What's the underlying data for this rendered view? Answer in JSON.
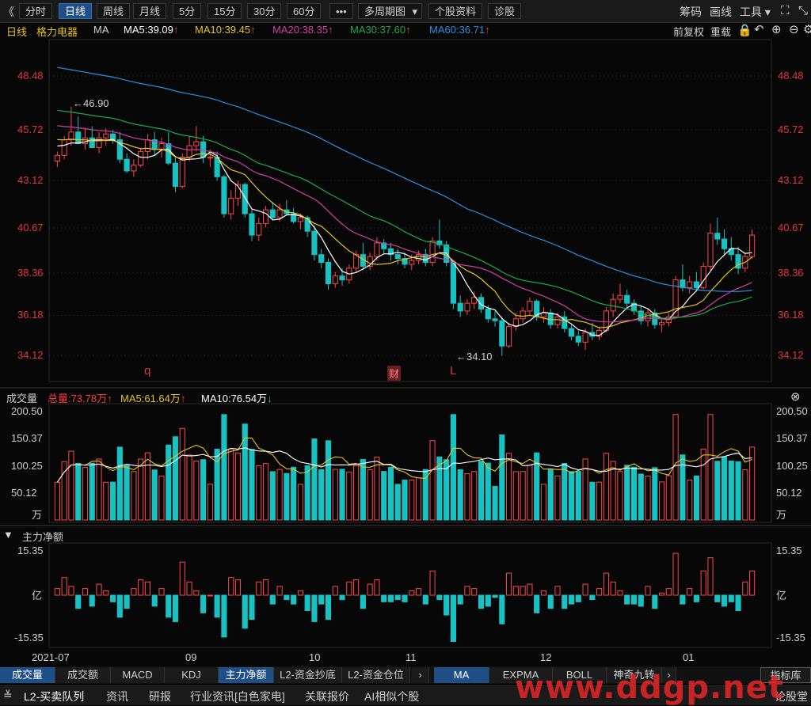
{
  "toolbar": {
    "back": "《",
    "periods": [
      "分时",
      "日线",
      "周线",
      "月线",
      "5分",
      "15分",
      "30分",
      "60分"
    ],
    "more": "•••",
    "multi_period": "多周期图",
    "stock_info": "个股资料",
    "diagnose": "诊股",
    "chips": "筹码",
    "drawing": "画线",
    "tools": "工具"
  },
  "ma_line": {
    "period": "日线",
    "stock": "格力电器",
    "ma_label": "MA",
    "ma5": "MA5:39.09",
    "ma10": "MA10:39.45",
    "ma20": "MA20:38.35",
    "ma30": "MA30:37.60",
    "ma60": "MA60:36.71",
    "adjust": "前复权",
    "reload": "重载",
    "colors": {
      "ma5": "#ffffff",
      "ma10": "#e8c21e",
      "ma20": "#d23ea8",
      "ma30": "#1faa4c",
      "ma60": "#2f8fe0"
    }
  },
  "price_axis": [
    "48.48",
    "45.72",
    "43.12",
    "40.67",
    "38.36",
    "36.18",
    "34.12"
  ],
  "annotations": {
    "high": "46.90",
    "low": "34.10",
    "q_marker": "q",
    "fin_marker": "财",
    "l_marker": "L"
  },
  "volume": {
    "title": "成交量",
    "total": "总量:73.78万",
    "ma5": "MA5:61.64万",
    "ma10": "MA10:76.54万",
    "axis": [
      "200.50",
      "150.37",
      "100.25",
      "50.12"
    ],
    "unit": "万"
  },
  "netflow": {
    "title": "主力净额",
    "axis_top": "15.35",
    "unit": "亿",
    "axis_bottom": "-15.35"
  },
  "x_axis": [
    "2021-07",
    "09",
    "10",
    "11",
    "12",
    "01"
  ],
  "indicator_tabs": [
    "成交量",
    "成交额",
    "MACD",
    "KDJ",
    "主力净额",
    "L2-资金抄底",
    "L2-资金仓位"
  ],
  "overlay_tabs": [
    "MA",
    "EXPMA",
    "BOLL",
    "神奇九转"
  ],
  "indicator_lib": "指标库",
  "status_tabs": [
    "L2-买卖队列",
    "资讯",
    "研报",
    "行业资讯[白色家电]",
    "关联报价",
    "AI相似个股",
    "论股堂"
  ],
  "watermark": "www.ddgp.net",
  "chart_data": {
    "type": "candlestick",
    "price_ylim": [
      34.12,
      48.48
    ],
    "volume_ylim": [
      0,
      200.5
    ],
    "netflow_ylim": [
      -15.35,
      15.35
    ],
    "candles": [
      [
        44.1,
        44.6,
        43.8,
        44.4
      ],
      [
        44.4,
        45.4,
        44.2,
        45.2
      ],
      [
        45.2,
        46.9,
        44.9,
        45.6
      ],
      [
        45.6,
        46.4,
        45.3,
        45.0
      ],
      [
        45.0,
        45.8,
        44.7,
        45.3
      ],
      [
        45.3,
        45.9,
        44.9,
        44.8
      ],
      [
        44.8,
        45.6,
        44.5,
        45.3
      ],
      [
        45.3,
        45.8,
        44.9,
        45.5
      ],
      [
        45.5,
        45.7,
        45.0,
        45.2
      ],
      [
        45.2,
        45.6,
        44.0,
        44.2
      ],
      [
        44.2,
        44.5,
        43.5,
        43.6
      ],
      [
        43.6,
        44.2,
        43.3,
        43.9
      ],
      [
        43.9,
        44.8,
        43.8,
        44.6
      ],
      [
        44.6,
        45.5,
        44.2,
        45.2
      ],
      [
        45.2,
        45.6,
        44.4,
        44.7
      ],
      [
        44.7,
        45.3,
        44.3,
        45.0
      ],
      [
        45.0,
        45.6,
        43.9,
        44.0
      ],
      [
        44.0,
        44.3,
        42.5,
        42.8
      ],
      [
        42.8,
        44.5,
        42.7,
        44.3
      ],
      [
        44.3,
        45.4,
        44.1,
        44.9
      ],
      [
        44.9,
        45.9,
        44.6,
        45.1
      ],
      [
        45.1,
        45.4,
        44.0,
        44.3
      ],
      [
        44.3,
        44.7,
        43.8,
        44.3
      ],
      [
        44.3,
        44.6,
        43.1,
        43.3
      ],
      [
        43.3,
        43.4,
        41.2,
        41.4
      ],
      [
        41.4,
        42.6,
        41.1,
        42.2
      ],
      [
        42.2,
        43.1,
        41.8,
        42.9
      ],
      [
        42.9,
        43.0,
        41.2,
        41.4
      ],
      [
        41.4,
        41.6,
        40.0,
        40.3
      ],
      [
        40.3,
        41.2,
        40.0,
        40.9
      ],
      [
        40.9,
        41.8,
        40.7,
        41.6
      ],
      [
        41.6,
        42.0,
        41.1,
        41.2
      ],
      [
        41.2,
        41.9,
        41.0,
        41.6
      ],
      [
        41.6,
        42.1,
        41.3,
        41.4
      ],
      [
        41.4,
        41.7,
        40.9,
        41.0
      ],
      [
        41.0,
        41.4,
        40.6,
        41.2
      ],
      [
        41.2,
        41.3,
        40.2,
        40.5
      ],
      [
        40.5,
        40.8,
        39.0,
        39.3
      ],
      [
        39.3,
        39.6,
        38.6,
        38.9
      ],
      [
        38.9,
        39.1,
        37.5,
        37.8
      ],
      [
        37.8,
        38.4,
        37.6,
        38.2
      ],
      [
        38.2,
        38.6,
        37.7,
        38.0
      ],
      [
        38.0,
        38.8,
        37.8,
        38.6
      ],
      [
        38.6,
        39.5,
        38.4,
        39.3
      ],
      [
        39.3,
        39.9,
        38.5,
        38.7
      ],
      [
        38.7,
        39.4,
        38.5,
        39.2
      ],
      [
        39.2,
        40.2,
        39.0,
        39.9
      ],
      [
        39.9,
        40.1,
        39.3,
        39.6
      ],
      [
        39.6,
        39.9,
        39.0,
        39.3
      ],
      [
        39.3,
        39.6,
        38.8,
        39.1
      ],
      [
        39.1,
        39.4,
        38.6,
        38.8
      ],
      [
        38.8,
        39.3,
        38.5,
        39.0
      ],
      [
        39.0,
        39.5,
        38.8,
        39.3
      ],
      [
        39.3,
        39.6,
        38.7,
        38.9
      ],
      [
        38.9,
        40.2,
        38.7,
        40.0
      ],
      [
        40.0,
        41.1,
        39.6,
        39.8
      ],
      [
        39.8,
        40.0,
        38.7,
        38.9
      ],
      [
        38.9,
        39.0,
        36.5,
        36.8
      ],
      [
        36.8,
        37.2,
        36.1,
        36.4
      ],
      [
        36.4,
        37.0,
        36.2,
        36.8
      ],
      [
        36.8,
        37.4,
        36.5,
        37.1
      ],
      [
        37.1,
        37.3,
        36.3,
        36.5
      ],
      [
        36.5,
        36.7,
        35.8,
        36.0
      ],
      [
        36.0,
        36.4,
        35.6,
        35.9
      ],
      [
        35.9,
        36.1,
        34.1,
        34.6
      ],
      [
        34.6,
        35.8,
        34.5,
        35.6
      ],
      [
        35.6,
        36.3,
        35.4,
        36.0
      ],
      [
        36.0,
        36.6,
        35.8,
        36.4
      ],
      [
        36.4,
        37.1,
        36.2,
        36.9
      ],
      [
        36.9,
        37.0,
        35.9,
        36.1
      ],
      [
        36.1,
        36.6,
        35.8,
        36.3
      ],
      [
        36.3,
        36.5,
        35.5,
        35.7
      ],
      [
        35.7,
        36.3,
        35.5,
        36.1
      ],
      [
        36.1,
        36.4,
        35.3,
        35.5
      ],
      [
        35.5,
        35.7,
        34.9,
        35.1
      ],
      [
        35.1,
        35.4,
        34.6,
        34.8
      ],
      [
        34.8,
        35.5,
        34.4,
        35.3
      ],
      [
        35.3,
        35.8,
        34.9,
        35.1
      ],
      [
        35.1,
        35.6,
        34.9,
        35.4
      ],
      [
        35.4,
        36.6,
        35.3,
        36.4
      ],
      [
        36.4,
        37.3,
        36.1,
        37.0
      ],
      [
        37.0,
        37.8,
        36.8,
        37.2
      ],
      [
        37.2,
        37.5,
        36.5,
        36.8
      ],
      [
        36.8,
        37.0,
        36.2,
        36.4
      ],
      [
        36.4,
        36.7,
        35.7,
        35.9
      ],
      [
        35.9,
        36.5,
        35.6,
        36.3
      ],
      [
        36.3,
        36.5,
        35.5,
        35.7
      ],
      [
        35.7,
        36.0,
        35.3,
        35.8
      ],
      [
        35.8,
        36.3,
        35.6,
        36.1
      ],
      [
        36.1,
        38.2,
        36.0,
        38.0
      ],
      [
        38.0,
        38.8,
        37.4,
        37.6
      ],
      [
        37.6,
        38.2,
        37.3,
        37.9
      ],
      [
        37.9,
        38.4,
        37.4,
        37.6
      ],
      [
        37.6,
        38.9,
        37.5,
        38.7
      ],
      [
        38.7,
        40.9,
        38.5,
        40.4
      ],
      [
        40.4,
        41.2,
        39.8,
        40.1
      ],
      [
        40.1,
        40.6,
        39.3,
        39.6
      ],
      [
        39.6,
        40.2,
        39.0,
        39.3
      ],
      [
        39.3,
        39.7,
        38.3,
        38.6
      ],
      [
        38.6,
        39.4,
        38.4,
        39.2
      ],
      [
        39.2,
        40.6,
        39.1,
        40.3
      ]
    ],
    "ma_visible": {
      "ma5": 39.09,
      "ma10": 39.45,
      "ma20": 38.35,
      "ma30": 37.6,
      "ma60": 36.71
    }
  }
}
